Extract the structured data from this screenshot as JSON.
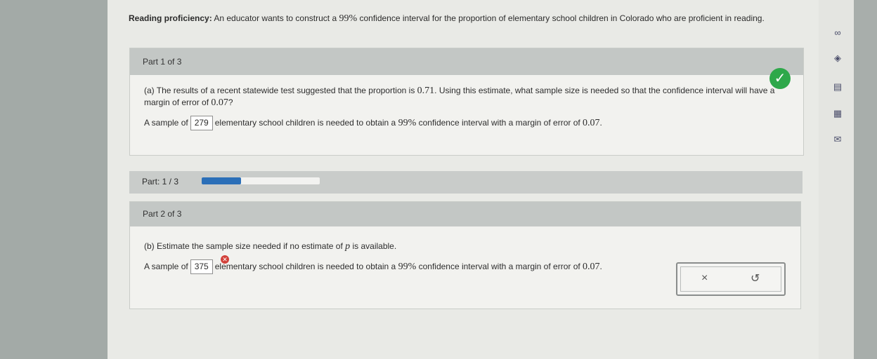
{
  "question": {
    "title": "Reading proficiency:",
    "text_before": "An educator wants to construct a ",
    "confidence": "99%",
    "text_after": " confidence interval for the proportion of elementary school children in Colorado who are proficient in reading."
  },
  "part1": {
    "header": "Part 1 of 3",
    "prompt_a": "(a) The results of a recent statewide test suggested that the proportion is ",
    "proportion": "0.71",
    "prompt_b": ". Using this estimate, what sample size is needed so that the confidence interval will have a margin of error of ",
    "margin": "0.07",
    "prompt_c": "?",
    "answer_prefix": "A sample of",
    "answer_value": "279",
    "answer_mid": "elementary school children is needed to obtain a",
    "answer_conf": "99%",
    "answer_mid2": "confidence interval with a margin of error of",
    "answer_margin": "0.07",
    "answer_end": ".",
    "status": "correct"
  },
  "progress": {
    "label": "Part: 1 / 3",
    "fraction": 0.333
  },
  "part2": {
    "header": "Part 2 of 3",
    "prompt_a": "(b) Estimate the sample size needed if no estimate of ",
    "variable": "p",
    "prompt_b": " is available.",
    "answer_prefix": "A sample of",
    "answer_value": "375",
    "answer_mid": "elementary school children is needed to obtain a",
    "answer_conf": "99%",
    "answer_mid2": "confidence interval with a margin of error of",
    "answer_margin": "0.07",
    "answer_end": ".",
    "status": "incorrect",
    "clear_symbol": "×",
    "undo_symbol": "↺"
  },
  "rail": {
    "icons": [
      "infinity-icon",
      "checkmark-circle-icon",
      "document-icon",
      "calculator-icon",
      "mail-icon"
    ],
    "glyphs": [
      "∞",
      "◈",
      "▤",
      "▦",
      "✉"
    ]
  },
  "colors": {
    "correct": "#2ea84a",
    "incorrect": "#d2413a",
    "progress": "#2b6fb8"
  }
}
